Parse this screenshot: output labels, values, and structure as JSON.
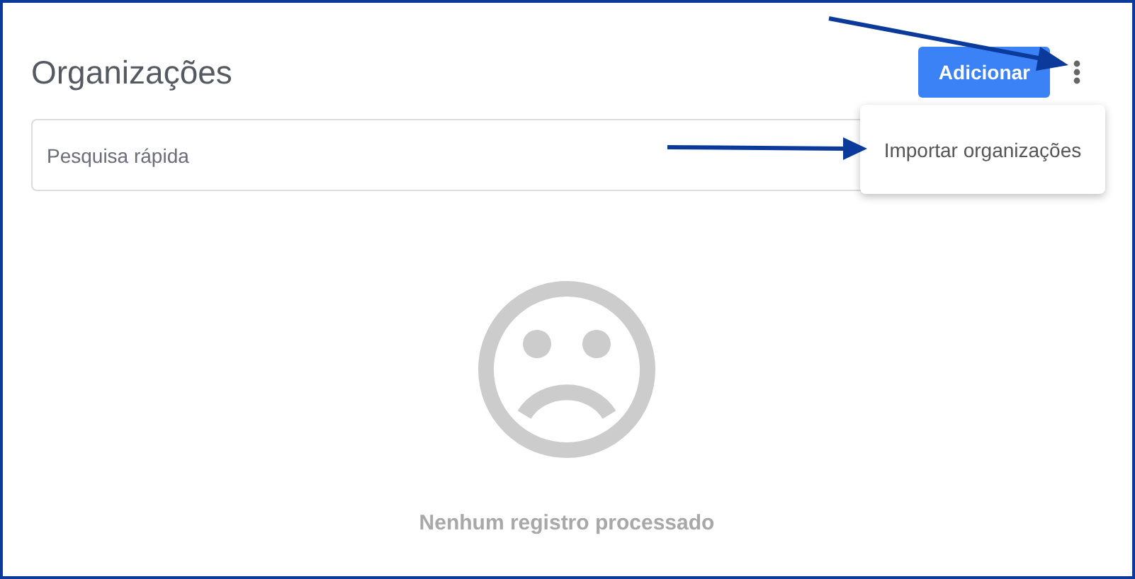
{
  "page": {
    "title": "Organizações"
  },
  "add_button": {
    "label": "Adicionar"
  },
  "search": {
    "placeholder": "Pesquisa rápida"
  },
  "menu": {
    "open": true,
    "items": [
      {
        "label": "Importar organizações"
      }
    ]
  },
  "empty_state": {
    "message": "Nenhum registro processado"
  }
}
